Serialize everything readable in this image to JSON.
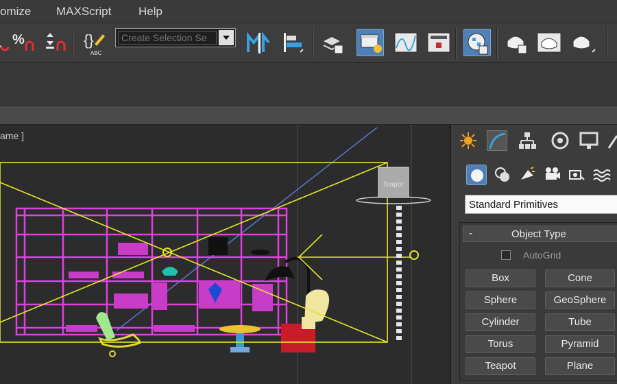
{
  "menu": {
    "items": [
      "omize",
      "MAXScript",
      "Help"
    ]
  },
  "toolbar": {
    "selection_set_placeholder": "Create Selection Se",
    "icons": [
      "snap-icon",
      "percent-snap-icon",
      "spinner-snap-icon",
      "edit-named-selections-icon",
      "mirror-icon",
      "align-icon",
      "layer-explorer-icon",
      "scene-explorer-icon",
      "curve-editor-icon",
      "schematic-view-icon",
      "material-editor-icon",
      "render-setup-icon",
      "rendered-frame-window-icon",
      "render-production-icon"
    ],
    "active_color": "#4e7fb6"
  },
  "viewport": {
    "label": "ame ]",
    "camera_tag": "Teapot",
    "colors": {
      "shelf": "#e040e0",
      "frustum": "#e6e62a",
      "lamp": "#d8d8d8",
      "chair": "#f0e6a0"
    }
  },
  "panel": {
    "tabs": [
      "create-tab",
      "modify-tab",
      "hierarchy-tab",
      "motion-tab",
      "display-tab",
      "utilities-tab"
    ],
    "subtabs": [
      "geometry-icon",
      "shapes-icon",
      "lights-icon",
      "cameras-icon",
      "helpers-icon",
      "space-warps-icon"
    ],
    "category": "Standard Primitives",
    "rollout_title": "Object Type",
    "rollout_toggle": "-",
    "autogrid_label": "AutoGrid",
    "buttons": [
      "Box",
      "Cone",
      "Sphere",
      "GeoSphere",
      "Cylinder",
      "Tube",
      "Torus",
      "Pyramid",
      "Teapot",
      "Plane"
    ]
  }
}
